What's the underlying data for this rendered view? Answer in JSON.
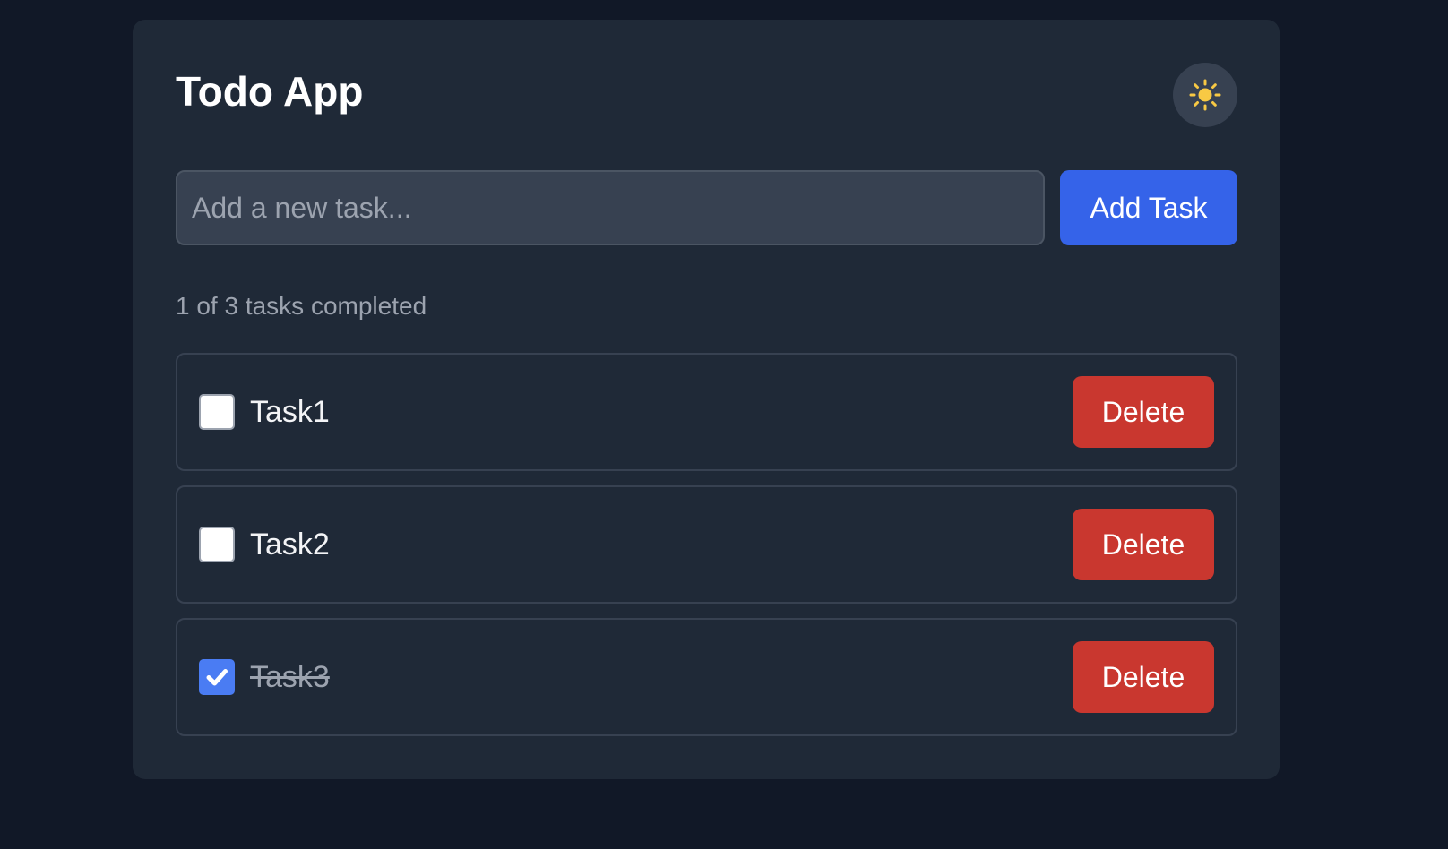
{
  "app": {
    "title": "Todo App",
    "theme_toggle_icon": "sun-icon"
  },
  "new_task": {
    "value": "",
    "placeholder": "Add a new task...",
    "add_label": "Add Task"
  },
  "summary": {
    "text": "1 of 3 tasks completed",
    "completed": 1,
    "total": 3
  },
  "tasks": [
    {
      "text": "Task1",
      "completed": false,
      "delete_label": "Delete"
    },
    {
      "text": "Task2",
      "completed": false,
      "delete_label": "Delete"
    },
    {
      "text": "Task3",
      "completed": true,
      "delete_label": "Delete"
    }
  ],
  "colors": {
    "page_background": "#111827",
    "card_background": "#1f2937",
    "accent": "#3563e9",
    "danger": "#c9372f",
    "sun": "#f8c944",
    "checked": "#4a7cf3"
  }
}
